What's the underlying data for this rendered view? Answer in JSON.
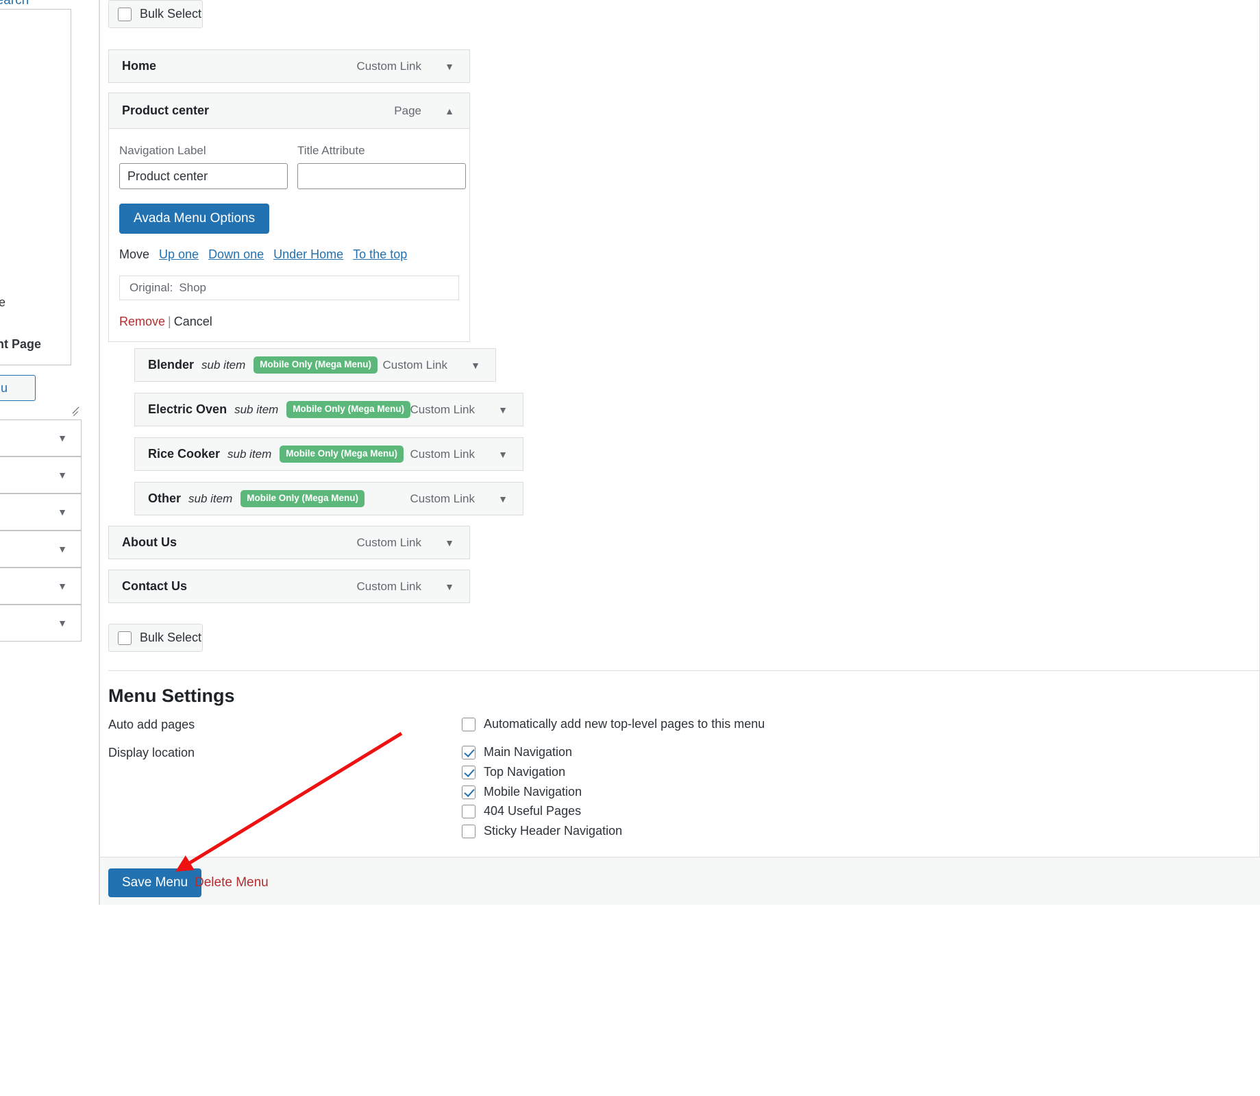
{
  "sidebar": {
    "search_label": "Search",
    "option_partial_1": "ge",
    "option_partial_2": "unt Page",
    "add_to_menu_button": "dd to Menu",
    "collapsed_panels": [
      {
        "chevron": "▼"
      },
      {
        "chevron": "▼"
      },
      {
        "chevron": "▼"
      },
      {
        "chevron": "▼"
      },
      {
        "chevron": "▼"
      },
      {
        "chevron": "▼"
      }
    ]
  },
  "bulk_select_top": {
    "label": "Bulk Select",
    "checked": false
  },
  "bulk_select_bottom": {
    "label": "Bulk Select",
    "checked": false
  },
  "menu_items": [
    {
      "title": "Home",
      "type": "Custom Link",
      "chevron": "▼"
    },
    {
      "title": "About Us",
      "type": "Custom Link",
      "chevron": "▼"
    },
    {
      "title": "Contact Us",
      "type": "Custom Link",
      "chevron": "▼"
    }
  ],
  "expanded_item": {
    "title": "Product center",
    "type": "Page",
    "chevron": "▲",
    "navigation_label_caption": "Navigation Label",
    "navigation_label_value": "Product center",
    "title_attribute_caption": "Title Attribute",
    "title_attribute_value": "",
    "avada_button": "Avada Menu Options",
    "move_caption": "Move",
    "move_links": [
      "Up one",
      "Down one",
      "Under Home",
      "To the top"
    ],
    "original_caption": "Original:",
    "original_value": "Shop",
    "remove_label": "Remove",
    "separator": "|",
    "cancel_label": "Cancel"
  },
  "sub_items": [
    {
      "title": "Blender",
      "sub_label": "sub item",
      "badge": "Mobile Only (Mega Menu)",
      "type": "Custom Link",
      "chevron": "▼"
    },
    {
      "title": "Electric Oven",
      "sub_label": "sub item",
      "badge": "Mobile Only (Mega Menu)",
      "type": "Custom Link",
      "chevron": "▼"
    },
    {
      "title": "Rice Cooker",
      "sub_label": "sub item",
      "badge": "Mobile Only (Mega Menu)",
      "type": "Custom Link",
      "chevron": "▼"
    },
    {
      "title": "Other",
      "sub_label": "sub item",
      "badge": "Mobile Only (Mega Menu)",
      "type": "Custom Link",
      "chevron": "▼"
    }
  ],
  "menu_settings": {
    "heading": "Menu Settings",
    "auto_add_label": "Auto add pages",
    "auto_add_option": {
      "label": "Automatically add new top-level pages to this menu",
      "checked": false
    },
    "display_location_label": "Display location",
    "locations": [
      {
        "label": "Main Navigation",
        "checked": true
      },
      {
        "label": "Top Navigation",
        "checked": true
      },
      {
        "label": "Mobile Navigation",
        "checked": true
      },
      {
        "label": "404 Useful Pages",
        "checked": false
      },
      {
        "label": "Sticky Header Navigation",
        "checked": false
      }
    ]
  },
  "footer": {
    "save_label": "Save Menu",
    "delete_label": "Delete Menu"
  },
  "annotation": {
    "arrow_color": "#ee1111"
  }
}
